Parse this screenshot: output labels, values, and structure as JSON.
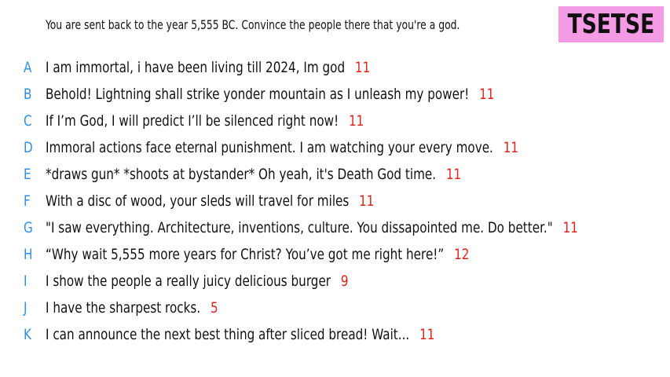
{
  "prompt": "You are sent back to the year 5,555 BC. Convince the people there that you're a god.",
  "player_badge": {
    "name": "TSETSE",
    "color": "#f59be6"
  },
  "colors": {
    "letter": "#2f8fe6",
    "score": "#e0231d",
    "text": "#111111"
  },
  "answers": [
    {
      "letter": "A",
      "text": "I am immortal, i have been living till 2024, Im god",
      "score": "11"
    },
    {
      "letter": "B",
      "text": "Behold! Lightning shall strike yonder mountain as I unleash my power!",
      "score": "11"
    },
    {
      "letter": "C",
      "text": "If I’m God, I will predict I’ll be silenced right now!",
      "score": "11"
    },
    {
      "letter": "D",
      "text": "Immoral actions face eternal punishment. I am watching your every move.",
      "score": "11"
    },
    {
      "letter": "E",
      "text": "*draws gun* *shoots at bystander* Oh yeah, it's Death God time.",
      "score": "11"
    },
    {
      "letter": "F",
      "text": "With a disc of wood, your sleds will travel for miles",
      "score": "11"
    },
    {
      "letter": "G",
      "text": "\"I saw everything. Architecture, inventions, culture. You dissapointed me. Do better.\"",
      "score": "11"
    },
    {
      "letter": "H",
      "text": "“Why wait 5,555 more years for Christ? You’ve got me right here!”",
      "score": "12"
    },
    {
      "letter": "I",
      "text": "I show the people a really juicy delicious burger",
      "score": "9"
    },
    {
      "letter": "J",
      "text": "I have the sharpest rocks.",
      "score": "5"
    },
    {
      "letter": "K",
      "text": "I can announce the next best thing after sliced bread! Wait...",
      "score": "11"
    }
  ]
}
